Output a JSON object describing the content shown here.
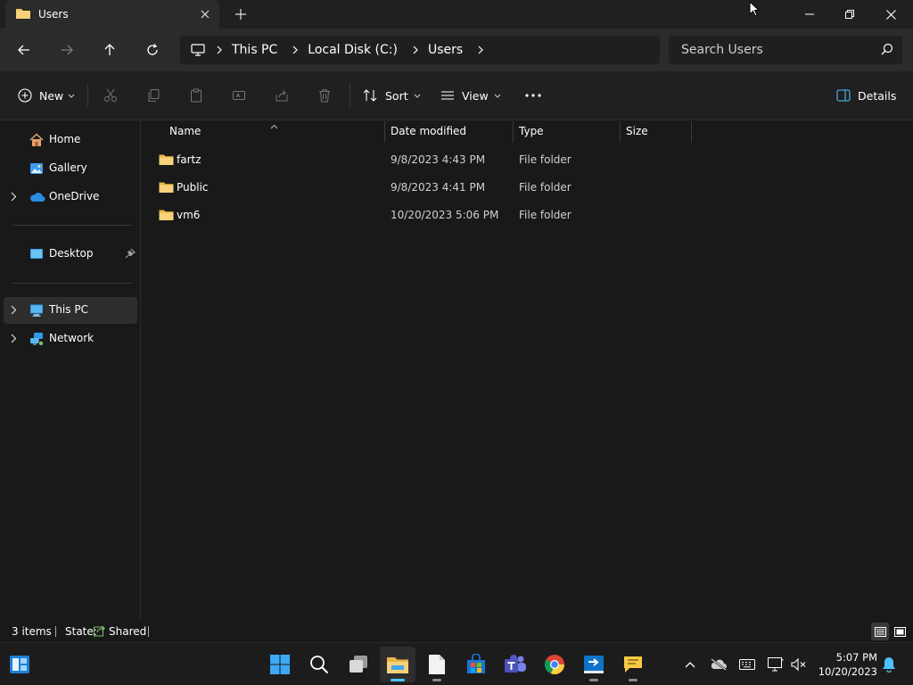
{
  "window": {
    "tab_title": "Users"
  },
  "address": {
    "crumbs": [
      "This PC",
      "Local Disk (C:)",
      "Users"
    ],
    "search_placeholder": "Search Users"
  },
  "toolbar": {
    "new_label": "New",
    "sort_label": "Sort",
    "view_label": "View",
    "details_label": "Details"
  },
  "sidebar": {
    "items": [
      {
        "label": "Home",
        "icon": "home-icon"
      },
      {
        "label": "Gallery",
        "icon": "gallery-icon"
      },
      {
        "label": "OneDrive",
        "icon": "cloud-icon"
      },
      {
        "label": "Desktop",
        "icon": "desktop-icon"
      },
      {
        "label": "This PC",
        "icon": "computer-icon"
      },
      {
        "label": "Network",
        "icon": "network-icon"
      }
    ]
  },
  "filelist": {
    "columns": [
      "Name",
      "Date modified",
      "Type",
      "Size"
    ],
    "rows": [
      {
        "name": "fartz",
        "date": "9/8/2023 4:43 PM",
        "type": "File folder",
        "size": ""
      },
      {
        "name": "Public",
        "date": "9/8/2023 4:41 PM",
        "type": "File folder",
        "size": ""
      },
      {
        "name": "vm6",
        "date": "10/20/2023 5:06 PM",
        "type": "File folder",
        "size": ""
      }
    ]
  },
  "status": {
    "count": "3 items",
    "state_label": "State:",
    "state_value": "Shared"
  },
  "clock": {
    "time": "5:07 PM",
    "date": "10/20/2023"
  },
  "colors": {
    "accent": "#4cc2ff",
    "folder": "#f2c55c"
  }
}
